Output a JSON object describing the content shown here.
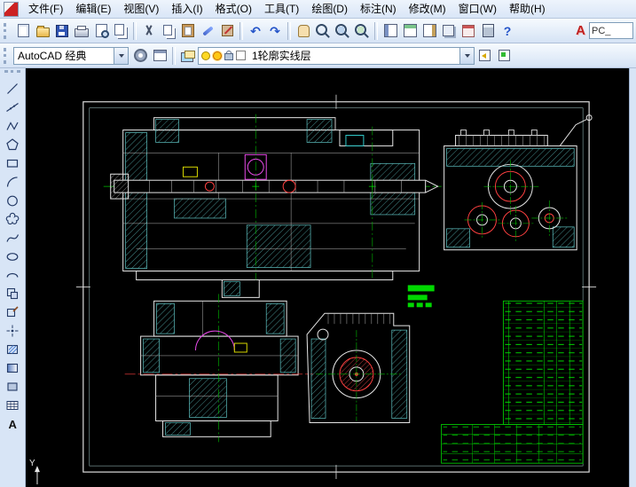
{
  "menu_bar": {
    "items": [
      "文件(F)",
      "编辑(E)",
      "视图(V)",
      "插入(I)",
      "格式(O)",
      "工具(T)",
      "绘图(D)",
      "标注(N)",
      "修改(M)",
      "窗口(W)",
      "帮助(H)"
    ]
  },
  "standard_toolbar": {
    "buttons": [
      "qnew",
      "open",
      "save",
      "plot",
      "plot-preview",
      "publish",
      "cut",
      "copy",
      "paste",
      "match-properties",
      "block-editor",
      "undo",
      "redo",
      "pan",
      "zoom-realtime",
      "zoom-window",
      "zoom-previous",
      "properties",
      "designcenter",
      "tool-palettes",
      "sheet-set-manager",
      "markup-set-manager",
      "quickcalc",
      "help"
    ],
    "glyphs": {
      "undo": "↶",
      "redo": "↷",
      "help": "?"
    }
  },
  "infocenter": {
    "logo": "A",
    "search_value": "PC_"
  },
  "workspace_toolbar": {
    "workspace_select": {
      "value": "AutoCAD 经典"
    },
    "buttons": [
      "workspace-settings",
      "customize-ui"
    ],
    "layer_buttons": [
      "layer-properties-manager",
      "layer-previous",
      "layer-states-manager"
    ],
    "layer_select": {
      "value": "1轮廓实线层",
      "indicators": [
        "on-bulb",
        "thaw-sun",
        "unlock",
        "color-swatch-white"
      ]
    }
  },
  "draw_toolbar": {
    "tools": [
      "line",
      "construction-line",
      "polyline",
      "polygon",
      "rectangle",
      "arc",
      "circle",
      "revision-cloud",
      "spline",
      "ellipse",
      "ellipse-arc",
      "insert-block",
      "make-block",
      "point",
      "hatch",
      "gradient",
      "region",
      "table",
      "multiline-text"
    ],
    "mtext_glyph": "A"
  },
  "canvas": {
    "ucs_y_label": "Y",
    "background": "#000000",
    "drawing_description": "Mechanical assembly drawing: longitudinal gearbox section (top-left), gear end view (top-right), apron section (bottom-left), end view with circular boss (bottom-center), green parts list table and title block (bottom-right)"
  },
  "colors": {
    "chrome": "#d8e5f6",
    "outline_white": "#e6e6e6",
    "hatch_cyan": "#66c8c8",
    "centerline_green": "#00c000",
    "detail_red": "#ff4040",
    "detail_magenta": "#e84ae8",
    "detail_yellow": "#d8d800",
    "table_green": "#00c800"
  }
}
